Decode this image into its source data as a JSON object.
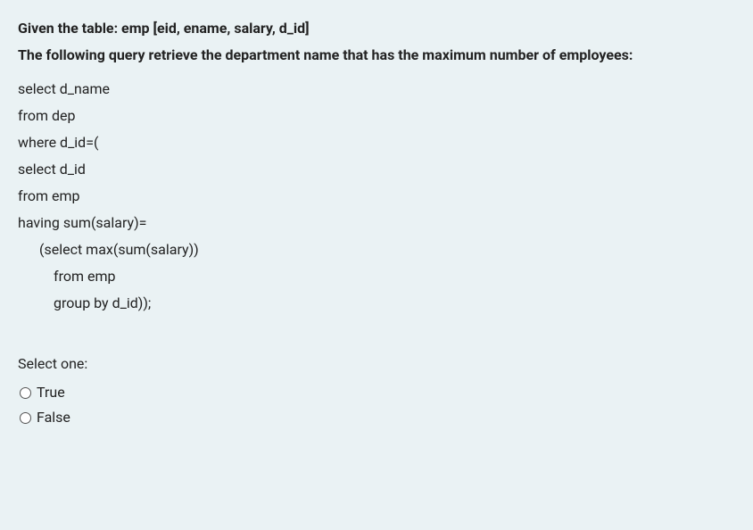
{
  "prompt": {
    "line1": "Given the table: emp [eid, ename, salary, d_id]",
    "line2": "The following query retrieve the department name that has the maximum number of employees:"
  },
  "query": {
    "l1": "select d_name",
    "l2": "from dep",
    "l3": "where d_id=(",
    "l4": "select d_id",
    "l5": "from emp",
    "l6": "having sum(salary)=",
    "l7": "(select max(sum(salary))",
    "l8": "from emp",
    "l9": "group by d_id));"
  },
  "answer": {
    "select_label": "Select one:",
    "options": {
      "true": "True",
      "false": "False"
    }
  }
}
